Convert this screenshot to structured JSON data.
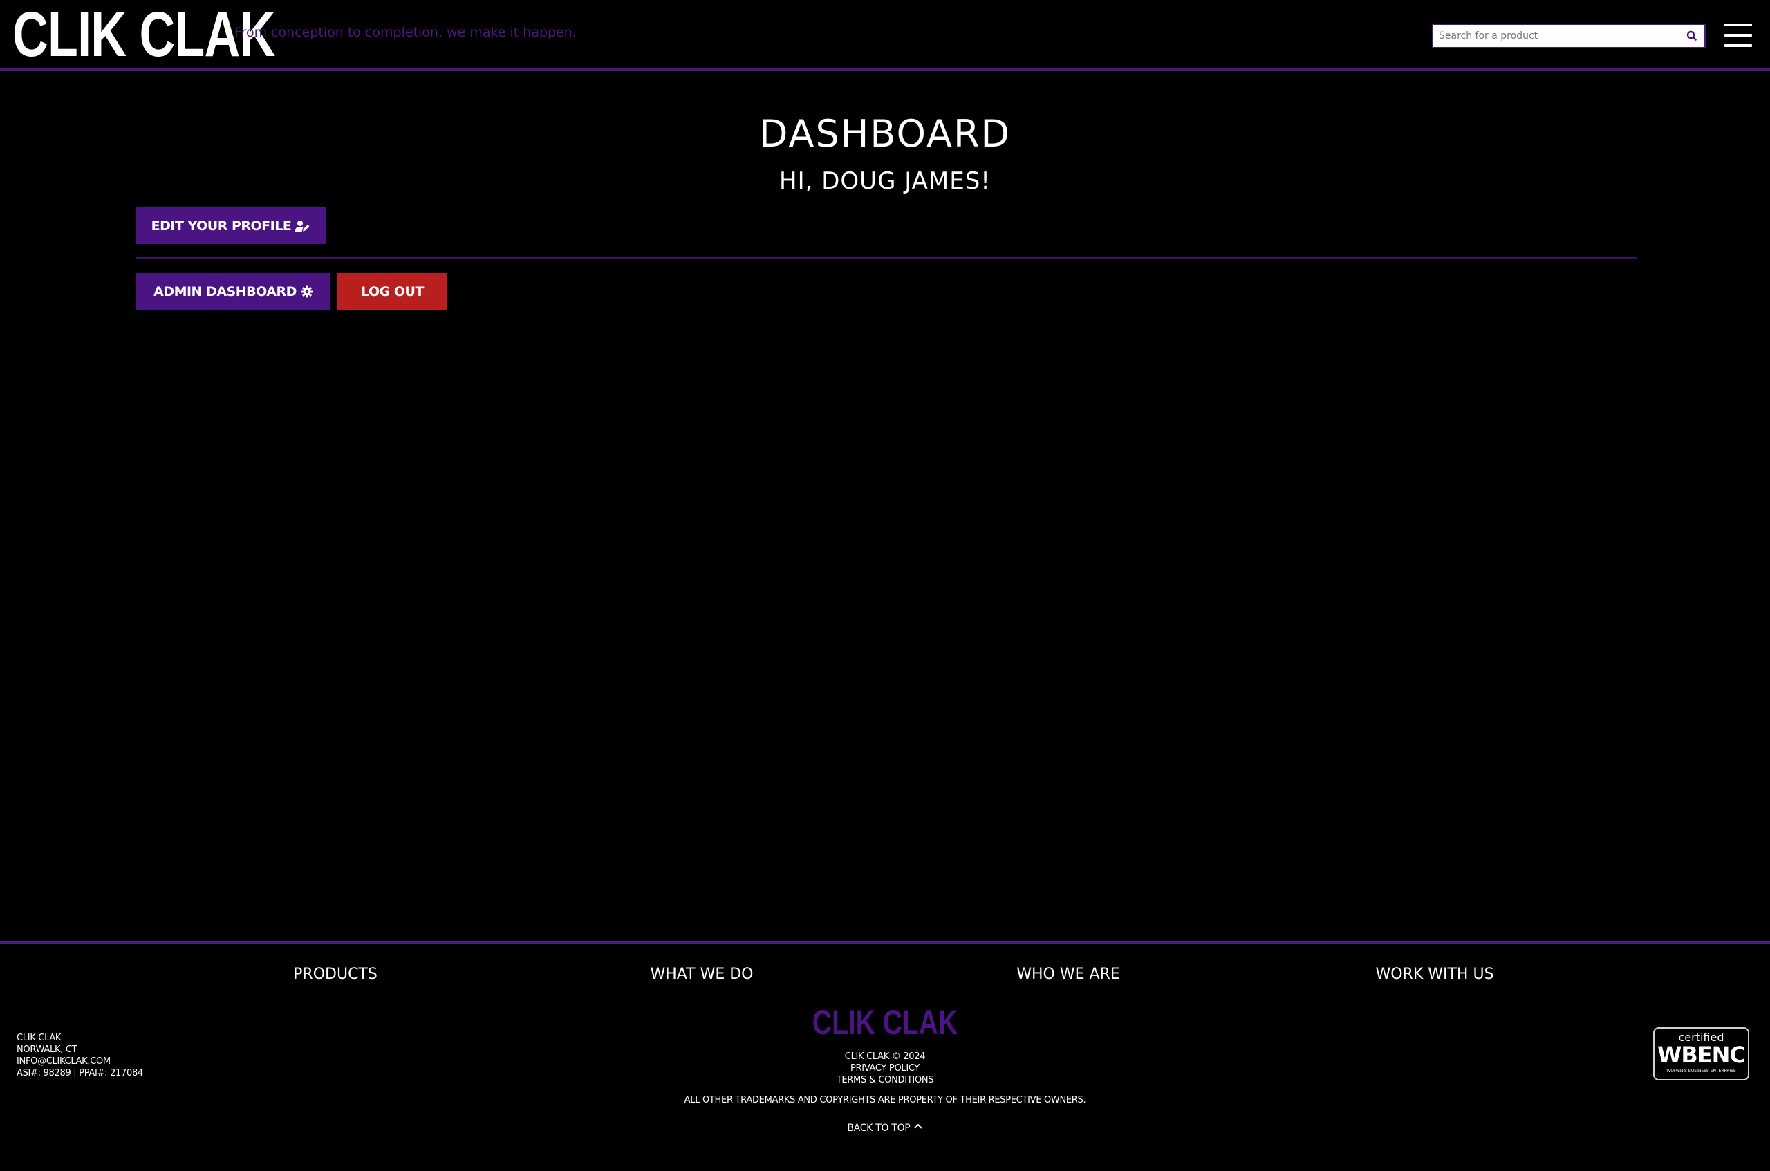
{
  "header": {
    "logo": "CLIK CLAK",
    "tagline": "From conception to completion, we make it happen.",
    "search_placeholder": "Search for a product"
  },
  "main": {
    "title": "DASHBOARD",
    "greeting": "HI, DOUG JAMES!",
    "edit_profile_label": "EDIT YOUR PROFILE",
    "admin_dashboard_label": "ADMIN DASHBOARD",
    "logout_label": "LOG OUT"
  },
  "footer": {
    "nav": [
      "PRODUCTS",
      "WHAT WE DO",
      "WHO WE ARE",
      "WORK WITH US"
    ],
    "address": {
      "company": "CLIK CLAK",
      "city": "NORWALK, CT",
      "email": "INFO@CLIKCLAK.COM",
      "ids": "ASI#: 98289 | PPAI#: 217084"
    },
    "logo": "CLIK CLAK",
    "copyright": "CLIK CLAK © 2024",
    "privacy": "PRIVACY POLICY",
    "terms": "TERMS & CONDITIONS",
    "trademarks": "ALL OTHER TRADEMARKS AND COPYRIGHTS ARE PROPERTY OF THEIR RESPECTIVE OWNERS.",
    "back_to_top": "BACK TO TOP",
    "badge": {
      "certified": "certified",
      "name": "WBENC",
      "sub": "WOMEN'S BUSINESS ENTERPRISE"
    }
  },
  "colors": {
    "accent_purple": "#4b1483",
    "logout_red": "#b91f1f",
    "background": "#000000"
  },
  "icons": [
    "search-icon",
    "menu-icon",
    "user-edit-icon",
    "gear-icon",
    "chevron-up-icon"
  ]
}
